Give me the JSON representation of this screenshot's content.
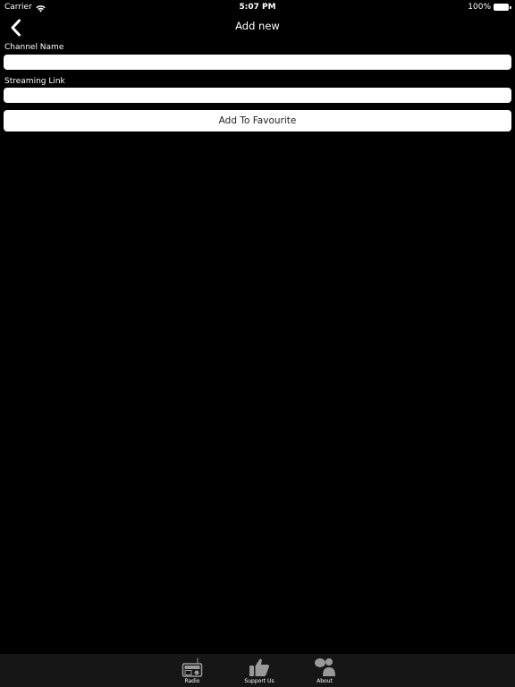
{
  "status_bar": {
    "carrier": "Carrier",
    "time": "5:07 PM",
    "battery": "100%"
  },
  "nav": {
    "title": "Add new",
    "back_icon": "chevron-left-icon"
  },
  "form": {
    "channel_name_label": "Channel Name",
    "channel_name_value": "",
    "streaming_link_label": "Streaming Link",
    "streaming_link_value": "",
    "submit_label": "Add To Favourite"
  },
  "tab_bar": {
    "items": [
      {
        "label": "Radio",
        "icon": "radio-icon"
      },
      {
        "label": "Support Us",
        "icon": "thumbs-up-icon"
      },
      {
        "label": "About",
        "icon": "people-icon"
      }
    ]
  },
  "colors": {
    "background": "#000000",
    "field_background": "#ffffff",
    "tab_bar_background": "#161616",
    "tab_icon": "#9a9a9a"
  }
}
